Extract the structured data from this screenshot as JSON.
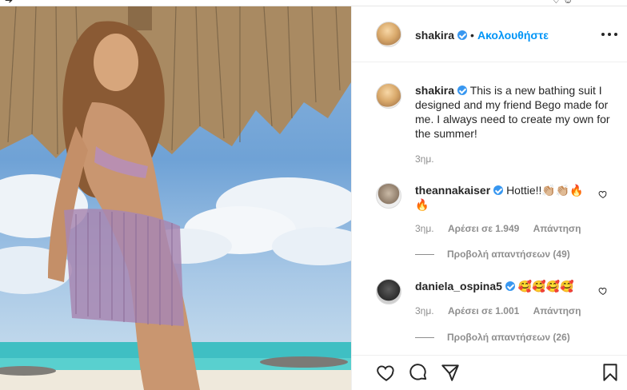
{
  "top_glyphs": {
    "left": "➔",
    "right": "♡ ☺"
  },
  "post": {
    "author": {
      "username": "shakira",
      "dot": "•",
      "follow_label": "Ακολουθήστε"
    },
    "caption": {
      "username": "shakira",
      "text": "This is a new bathing suit I designed and my friend Bego made for me. I always need to create my own for the summer!",
      "time": "3ημ."
    },
    "comments": [
      {
        "username": "theannakaiser",
        "text": "Hottie!!👏🏼👏🏼🔥🔥",
        "time": "3ημ.",
        "likes": "Αρέσει σε 1.949",
        "reply_label": "Απάντηση",
        "view_replies": "Προβολή απαντήσεων (49)"
      },
      {
        "username": "daniela_ospina5",
        "text": "🥰🥰🥰🥰",
        "time": "3ημ.",
        "likes": "Αρέσει σε 1.001",
        "reply_label": "Απάντηση",
        "view_replies": "Προβολή απαντήσεων (26)"
      }
    ],
    "icons": [
      "heart-icon",
      "comment-icon",
      "share-icon",
      "bookmark-icon",
      "more-icon",
      "verified-icon"
    ]
  },
  "colors": {
    "link": "#0095f6",
    "verified": "#3897f0",
    "text": "#262626",
    "muted": "#8e8e8e"
  }
}
